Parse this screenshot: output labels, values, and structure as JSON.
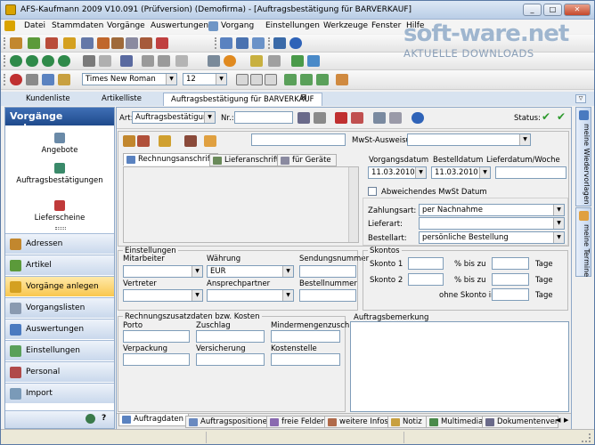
{
  "window": {
    "title": "AFS-Kaufmann 2009 V10.091 (Prüfversion) (Demofirma) - [Auftragsbestätigung für BARVERKAUF]",
    "controls": {
      "minimize": "_",
      "maximize": "□",
      "close": "✕"
    }
  },
  "watermark": {
    "brand": "soft-ware.net",
    "tagline": "AKTUELLE DOWNLOADS"
  },
  "menu": [
    "Datei",
    "Stammdaten",
    "Vorgänge",
    "Auswertungen",
    "Vorgang",
    "Einstellungen",
    "Werkzeuge",
    "Fenster",
    "Hilfe"
  ],
  "format_toolbar": {
    "font_name": "Times New Roman",
    "font_size": "12"
  },
  "tabs": [
    "Kundenliste",
    "Artikelliste",
    "Auftragsbestätigung für BARVERKAUF"
  ],
  "tab_close": "⊠",
  "sidebar": {
    "title": "Vorgänge anlegen",
    "actions": [
      "Angebote",
      "Auftragsbestätigungen",
      "Lieferscheine"
    ],
    "nav": [
      "Adressen",
      "Artikel",
      "Vorgänge anlegen",
      "Vorgangslisten",
      "Auswertungen",
      "Einstellungen",
      "Personal",
      "Import"
    ],
    "active_nav": "Vorgänge anlegen"
  },
  "header": {
    "art_label": "Art:",
    "art_value": "Auftragsbestätigung",
    "nr_label": "Nr.:",
    "nr_value": "",
    "status_label": "Status:"
  },
  "customer": {
    "mwst_label": "MwSt-Ausweisung:",
    "mwst_value": "",
    "address_tabs": [
      "Rechnungsanschrift",
      "Lieferanschrift",
      "für Geräte"
    ]
  },
  "dates": {
    "vorgangsdatum_label": "Vorgangsdatum",
    "vorgangsdatum": "11.03.2010",
    "bestelldatum_label": "Bestelldatum",
    "bestelldatum": "11.03.2010",
    "lieferdatum_label": "Lieferdatum/Woche",
    "lieferdatum": "",
    "abw_mwst_label": "Abweichendes MwSt Datum"
  },
  "terms": {
    "zahlungsart_label": "Zahlungsart:",
    "zahlungsart": "per Nachnahme",
    "lieferart_label": "Lieferart:",
    "lieferart": "",
    "bestellart_label": "Bestellart:",
    "bestellart": "persönliche Bestellung"
  },
  "settings": {
    "group": "Einstellungen",
    "mitarbeiter_label": "Mitarbeiter",
    "waehrung_label": "Währung",
    "waehrung": "EUR",
    "sendungsnummer_label": "Sendungsnummer",
    "vertreter_label": "Vertreter",
    "ansprechpartner_label": "Ansprechpartner",
    "bestellnummer_label": "Bestellnummer"
  },
  "skonto": {
    "group": "Skontos",
    "skonto1_label": "Skonto 1",
    "skonto2_label": "Skonto 2",
    "pct_label": "% bis zu",
    "tage_label": "Tage",
    "ohne_label": "ohne Skonto in"
  },
  "extra_costs": {
    "group": "Rechnungszusatzdaten bzw. Kosten",
    "porto": "Porto",
    "zuschlag": "Zuschlag",
    "mindermengenzuschlag": "Mindermengenzuschlag",
    "verpackung": "Verpackung",
    "versicherung": "Versicherung",
    "kostenstelle": "Kostenstelle"
  },
  "remark": {
    "label": "Auftragsbemerkung"
  },
  "right_tabs": [
    "meine Wiedervorlagen",
    "meine Termine"
  ],
  "bottom_tabs": [
    "Auftragdaten",
    "Auftragspositionen",
    "freie Felder",
    "weitere Infos",
    "Notiz",
    "Multimedia",
    "Dokumentenver"
  ],
  "colors": {
    "accent": "#1f4a8c",
    "active_nav": "#f9c74f",
    "check_green": "#2e9a2e"
  }
}
